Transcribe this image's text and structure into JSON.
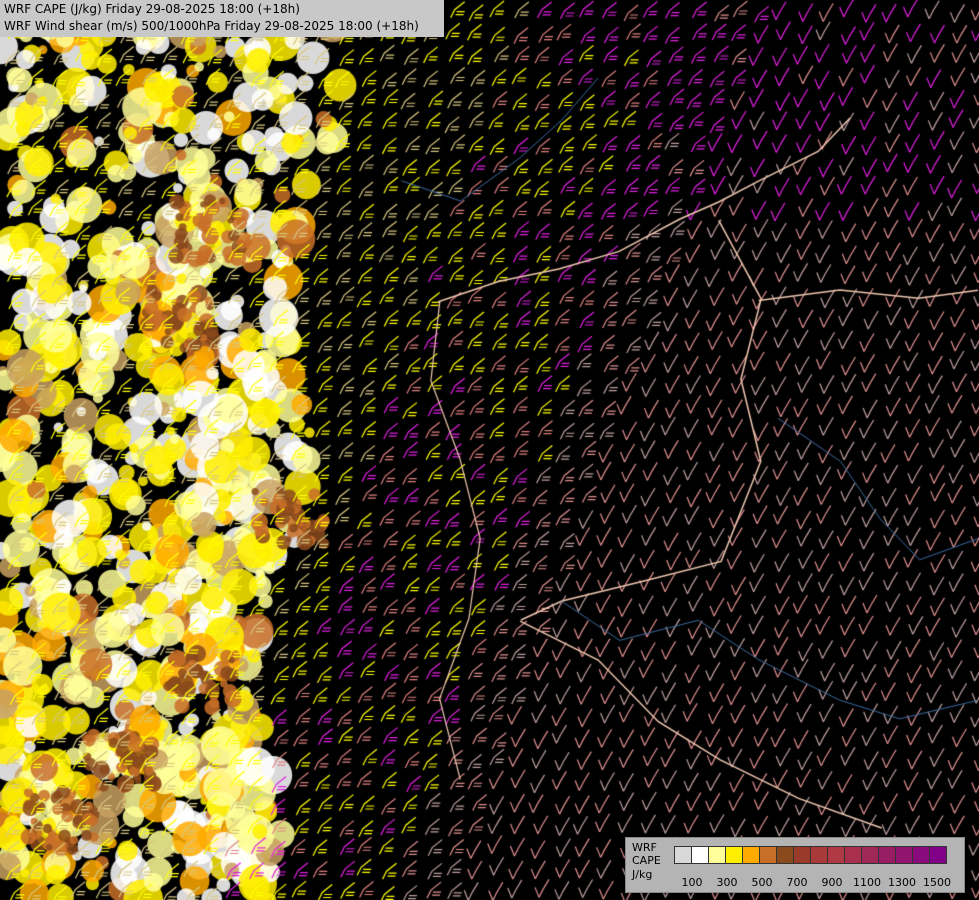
{
  "header": {
    "line1": "WRF CAPE (J/kg) Friday 29-08-2025 18:00 (+18h)",
    "line2": "WRF Wind shear (m/s) 500/1000hPa Friday 29-08-2025 18:00 (+18h)"
  },
  "legend": {
    "label_line1": "WRF",
    "label_line2": "CAPE",
    "label_line3": "J/kg",
    "colors": [
      "#d8d8d8",
      "#ffffff",
      "#ffff99",
      "#ffee00",
      "#ffaa00",
      "#c86e28",
      "#8b4a1c",
      "#9a3a2a",
      "#a83a3a",
      "#b03a44",
      "#a8304c",
      "#a02858",
      "#981e64",
      "#901470",
      "#880a7c",
      "#800088"
    ],
    "ticks": [
      "100",
      "300",
      "500",
      "700",
      "900",
      "1100",
      "1300",
      "1500"
    ]
  }
}
